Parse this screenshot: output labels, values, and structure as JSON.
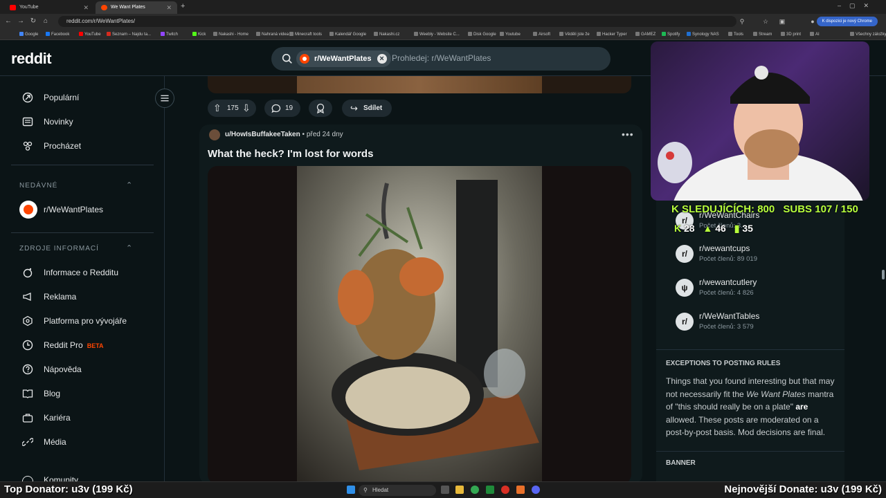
{
  "browser": {
    "tabs": [
      {
        "label": "YouTube",
        "active": false,
        "color": "#ff0000"
      },
      {
        "label": "We Want Plates",
        "active": true,
        "color": "#ff4500"
      }
    ],
    "url": "reddit.com/r/WeWantPlates/",
    "chrome_notice": "K dispozici je nový Chrome",
    "bookmarks": [
      "Google",
      "Facebook",
      "YouTube",
      "Seznam – Najdu ta...",
      "Twitch",
      "Kick",
      "Nakashi - Home",
      "Nahraná videa",
      "Minecraft tools",
      "Kalendář Google",
      "Nakashi.cz",
      "Weebly - Website C...",
      "Disk Google",
      "Youtube",
      "Airsoft",
      "Věděli jste že",
      "Hacker Typer",
      "GAMEZ",
      "Spotify",
      "Synology NAS",
      "Tools",
      "Stream",
      "3D print",
      "AI",
      "Všechny záložky"
    ]
  },
  "header": {
    "logo": "reddit",
    "search_chip": "r/WeWantPlates",
    "search_placeholder": "Prohledej: r/WeWantPlates"
  },
  "sidebar": {
    "top_items": [
      {
        "label": "Populární",
        "icon": "popular-icon"
      },
      {
        "label": "Novinky",
        "icon": "news-icon"
      },
      {
        "label": "Procházet",
        "icon": "explore-icon"
      }
    ],
    "recent_heading": "NEDÁVNÉ",
    "recent_items": [
      {
        "label": "r/WeWantPlates"
      }
    ],
    "resources_heading": "ZDROJE INFORMACÍ",
    "resources_items": [
      {
        "label": "Informace o Redditu",
        "icon": "about-icon"
      },
      {
        "label": "Reklama",
        "icon": "megaphone-icon"
      },
      {
        "label": "Platforma pro vývojáře",
        "icon": "developer-icon"
      },
      {
        "label": "Reddit Pro",
        "icon": "pro-icon",
        "badge": "BETA"
      },
      {
        "label": "Nápověda",
        "icon": "help-icon"
      },
      {
        "label": "Blog",
        "icon": "book-icon"
      },
      {
        "label": "Kariéra",
        "icon": "briefcase-icon"
      },
      {
        "label": "Média",
        "icon": "link-icon"
      }
    ],
    "cut_item": "Komunity"
  },
  "prev_post_actions": {
    "upvotes": "175",
    "comments": "19",
    "share": "Sdílet"
  },
  "post": {
    "author": "u/HowIsBuffakeeTaken",
    "separator": "•",
    "time": "před 24 dny",
    "title": "What the heck? I'm lost for words"
  },
  "overlay": {
    "followers": "SLEDUJÍCÍCH: 800",
    "subs": "SUBS 107 / 150",
    "kick_count": "28",
    "up_count": "46",
    "bar_count": "35"
  },
  "right_sidebar": {
    "related": [
      {
        "name": "r/WeWantChairs",
        "members": "Počet členů: 3..."
      },
      {
        "name": "r/wewantcups",
        "members": "Počet členů: 89 019"
      },
      {
        "name": "r/wewantcutlery",
        "members": "Počet členů: 4 826"
      },
      {
        "name": "r/WeWantTables",
        "members": "Počet členů: 3 579"
      }
    ],
    "rules_heading": "EXCEPTIONS TO POSTING RULES",
    "rules_text_1": "Things that you found interesting but that may not necessarily fit the ",
    "rules_italic": "We Want Plates",
    "rules_text_2": " mantra of \"this should really be on a plate\" ",
    "rules_bold": "are",
    "rules_text_3": " allowed. These posts are moderated on a post-by-post basis. Mod decisions are final.",
    "banner_heading": "BANNER"
  },
  "taskbar": {
    "top_donator": "Top Donator: u3v (199 Kč)",
    "search": "Hledat",
    "newest_donate": "Nejnovější Donate: u3v (199 Kč)"
  },
  "colors": {
    "reddit_orange": "#ff4500",
    "background": "#0b1416",
    "overlay_green": "#b7ff3c"
  }
}
